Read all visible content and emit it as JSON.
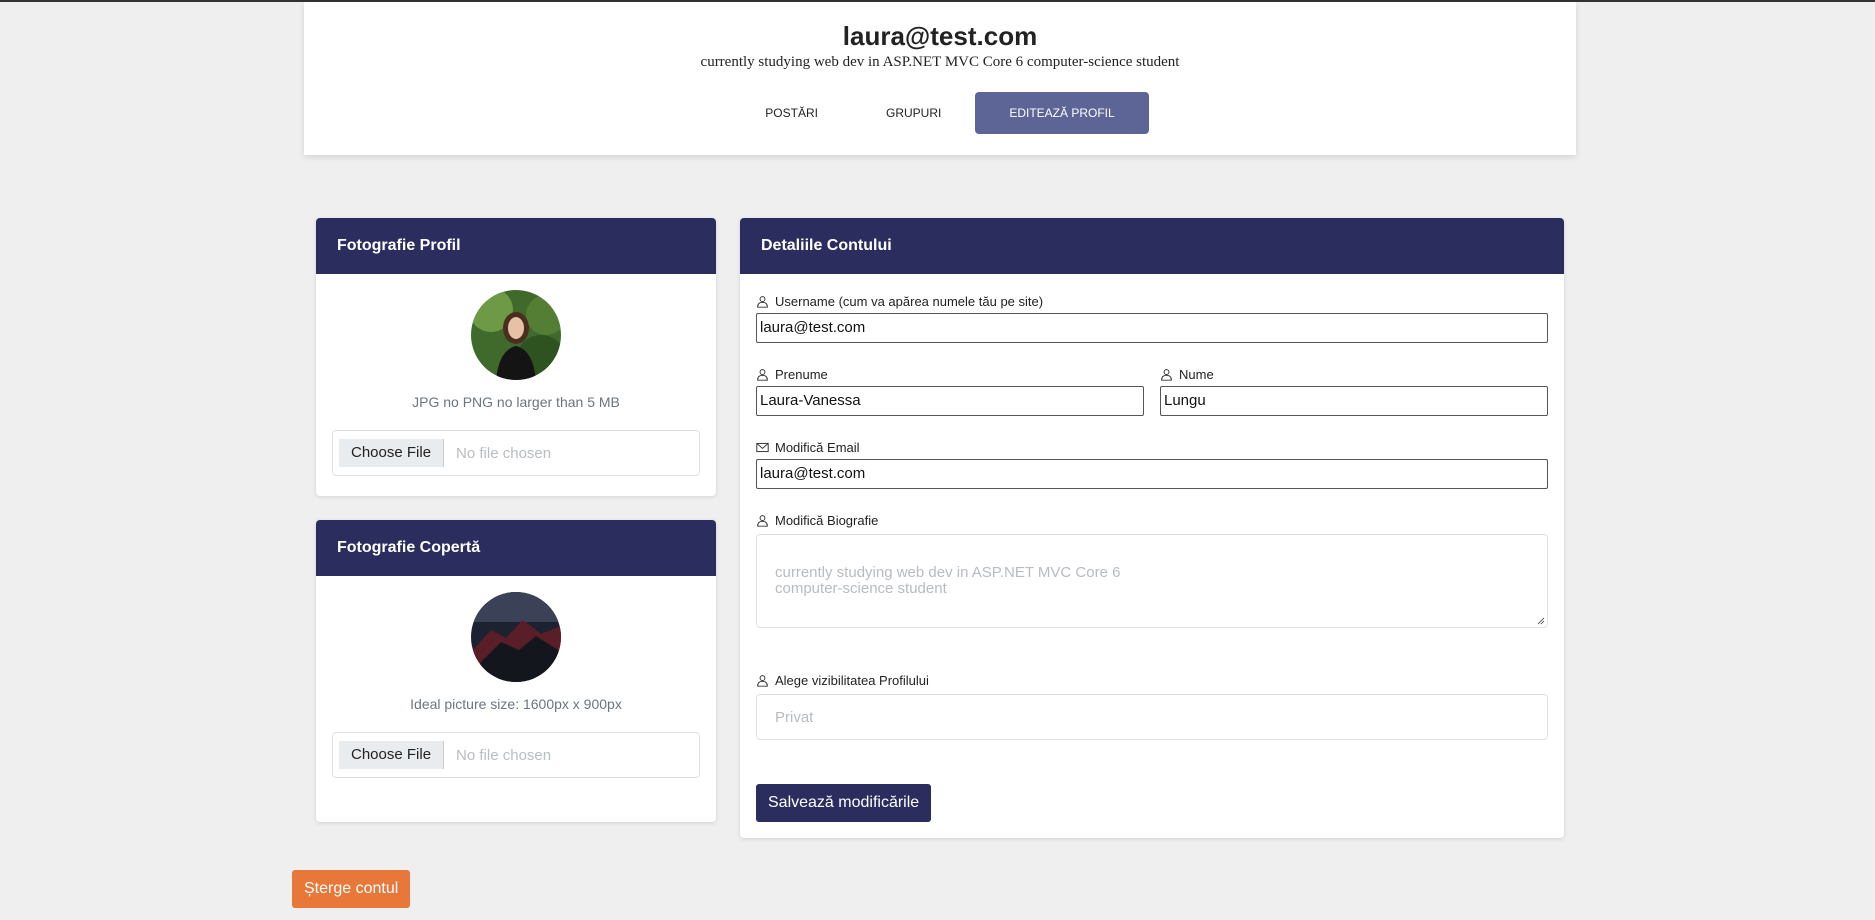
{
  "profile": {
    "username": "laura@test.com",
    "bio": "currently studying web dev in ASP.NET MVC Core 6 computer-science student"
  },
  "tabs": [
    "POSTĂRI",
    "GRUPURI",
    "EDITEAZĂ PROFIL"
  ],
  "profile_photo": {
    "title": "Fotografie Profil",
    "hint": "JPG no PNG no larger than 5 MB",
    "file_button": "Choose File",
    "file_status": "No file chosen"
  },
  "cover_photo": {
    "title": "Fotografie Copertă",
    "hint": "Ideal picture size: 1600px x 900px",
    "file_button": "Choose File",
    "file_status": "No file chosen"
  },
  "details": {
    "title": "Detaliile Contului",
    "username_label": "Username (cum va apărea numele tău pe site)",
    "username_value": "laura@test.com",
    "firstname_label": "Prenume",
    "firstname_value": "Laura-Vanessa",
    "lastname_label": "Nume",
    "lastname_value": "Lungu",
    "email_label": "Modifică Email",
    "email_value": "laura@test.com",
    "bio_label": "Modifică Biografie",
    "bio_placeholder": "currently studying web dev in ASP.NET MVC Core 6\ncomputer-science student",
    "visibility_label": "Alege vizibilitatea Profilului",
    "visibility_value": "Privat",
    "save_button": "Salvează modificările"
  },
  "delete_button": "Șterge contul",
  "colors": {
    "header_bg": "#2b2d5e",
    "active_tab": "#5d6496",
    "delete": "#e8773a"
  }
}
